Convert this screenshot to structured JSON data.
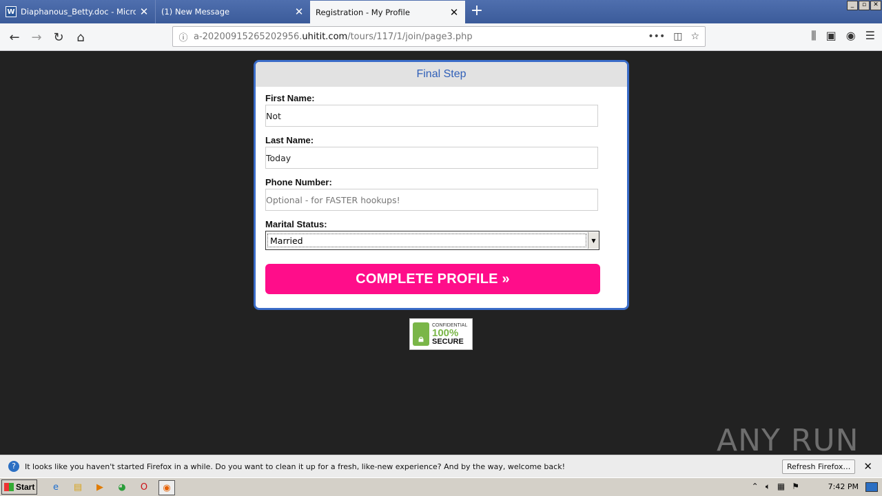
{
  "browser": {
    "tabs": [
      {
        "title": "Diaphanous_Betty.doc - Microsoft",
        "icon": "word-icon"
      },
      {
        "title": "(1) New Message",
        "icon": ""
      },
      {
        "title": "Registration - My Profile",
        "icon": "",
        "active": true
      }
    ],
    "url_prefix": "a-20200915265202956.",
    "url_domain": "uhitit.com",
    "url_path": "/tours/117/1/join/page3.php"
  },
  "form": {
    "heading": "Final Step",
    "first_name_label": "First Name:",
    "first_name_value": "Not",
    "last_name_label": "Last Name:",
    "last_name_value": "Today",
    "phone_label": "Phone Number:",
    "phone_placeholder": "Optional - for FASTER hookups!",
    "marital_label": "Marital Status:",
    "marital_value": "Married",
    "submit_label": "COMPLETE PROFILE »"
  },
  "seal": {
    "line1": "CONFIDENTIAL",
    "line2": "100%",
    "line3": "SECURE"
  },
  "watermark": "ANY RUN",
  "notification": {
    "message": "It looks like you haven't started Firefox in a while. Do you want to clean it up for a fresh, like-new experience? And by the way, welcome back!",
    "button": "Refresh Firefox…"
  },
  "taskbar": {
    "start": "Start",
    "clock": "7:42 PM"
  },
  "colors": {
    "accent_blue": "#3a6cc8",
    "cta_pink": "#ff0d8a",
    "page_bg": "#222222"
  }
}
